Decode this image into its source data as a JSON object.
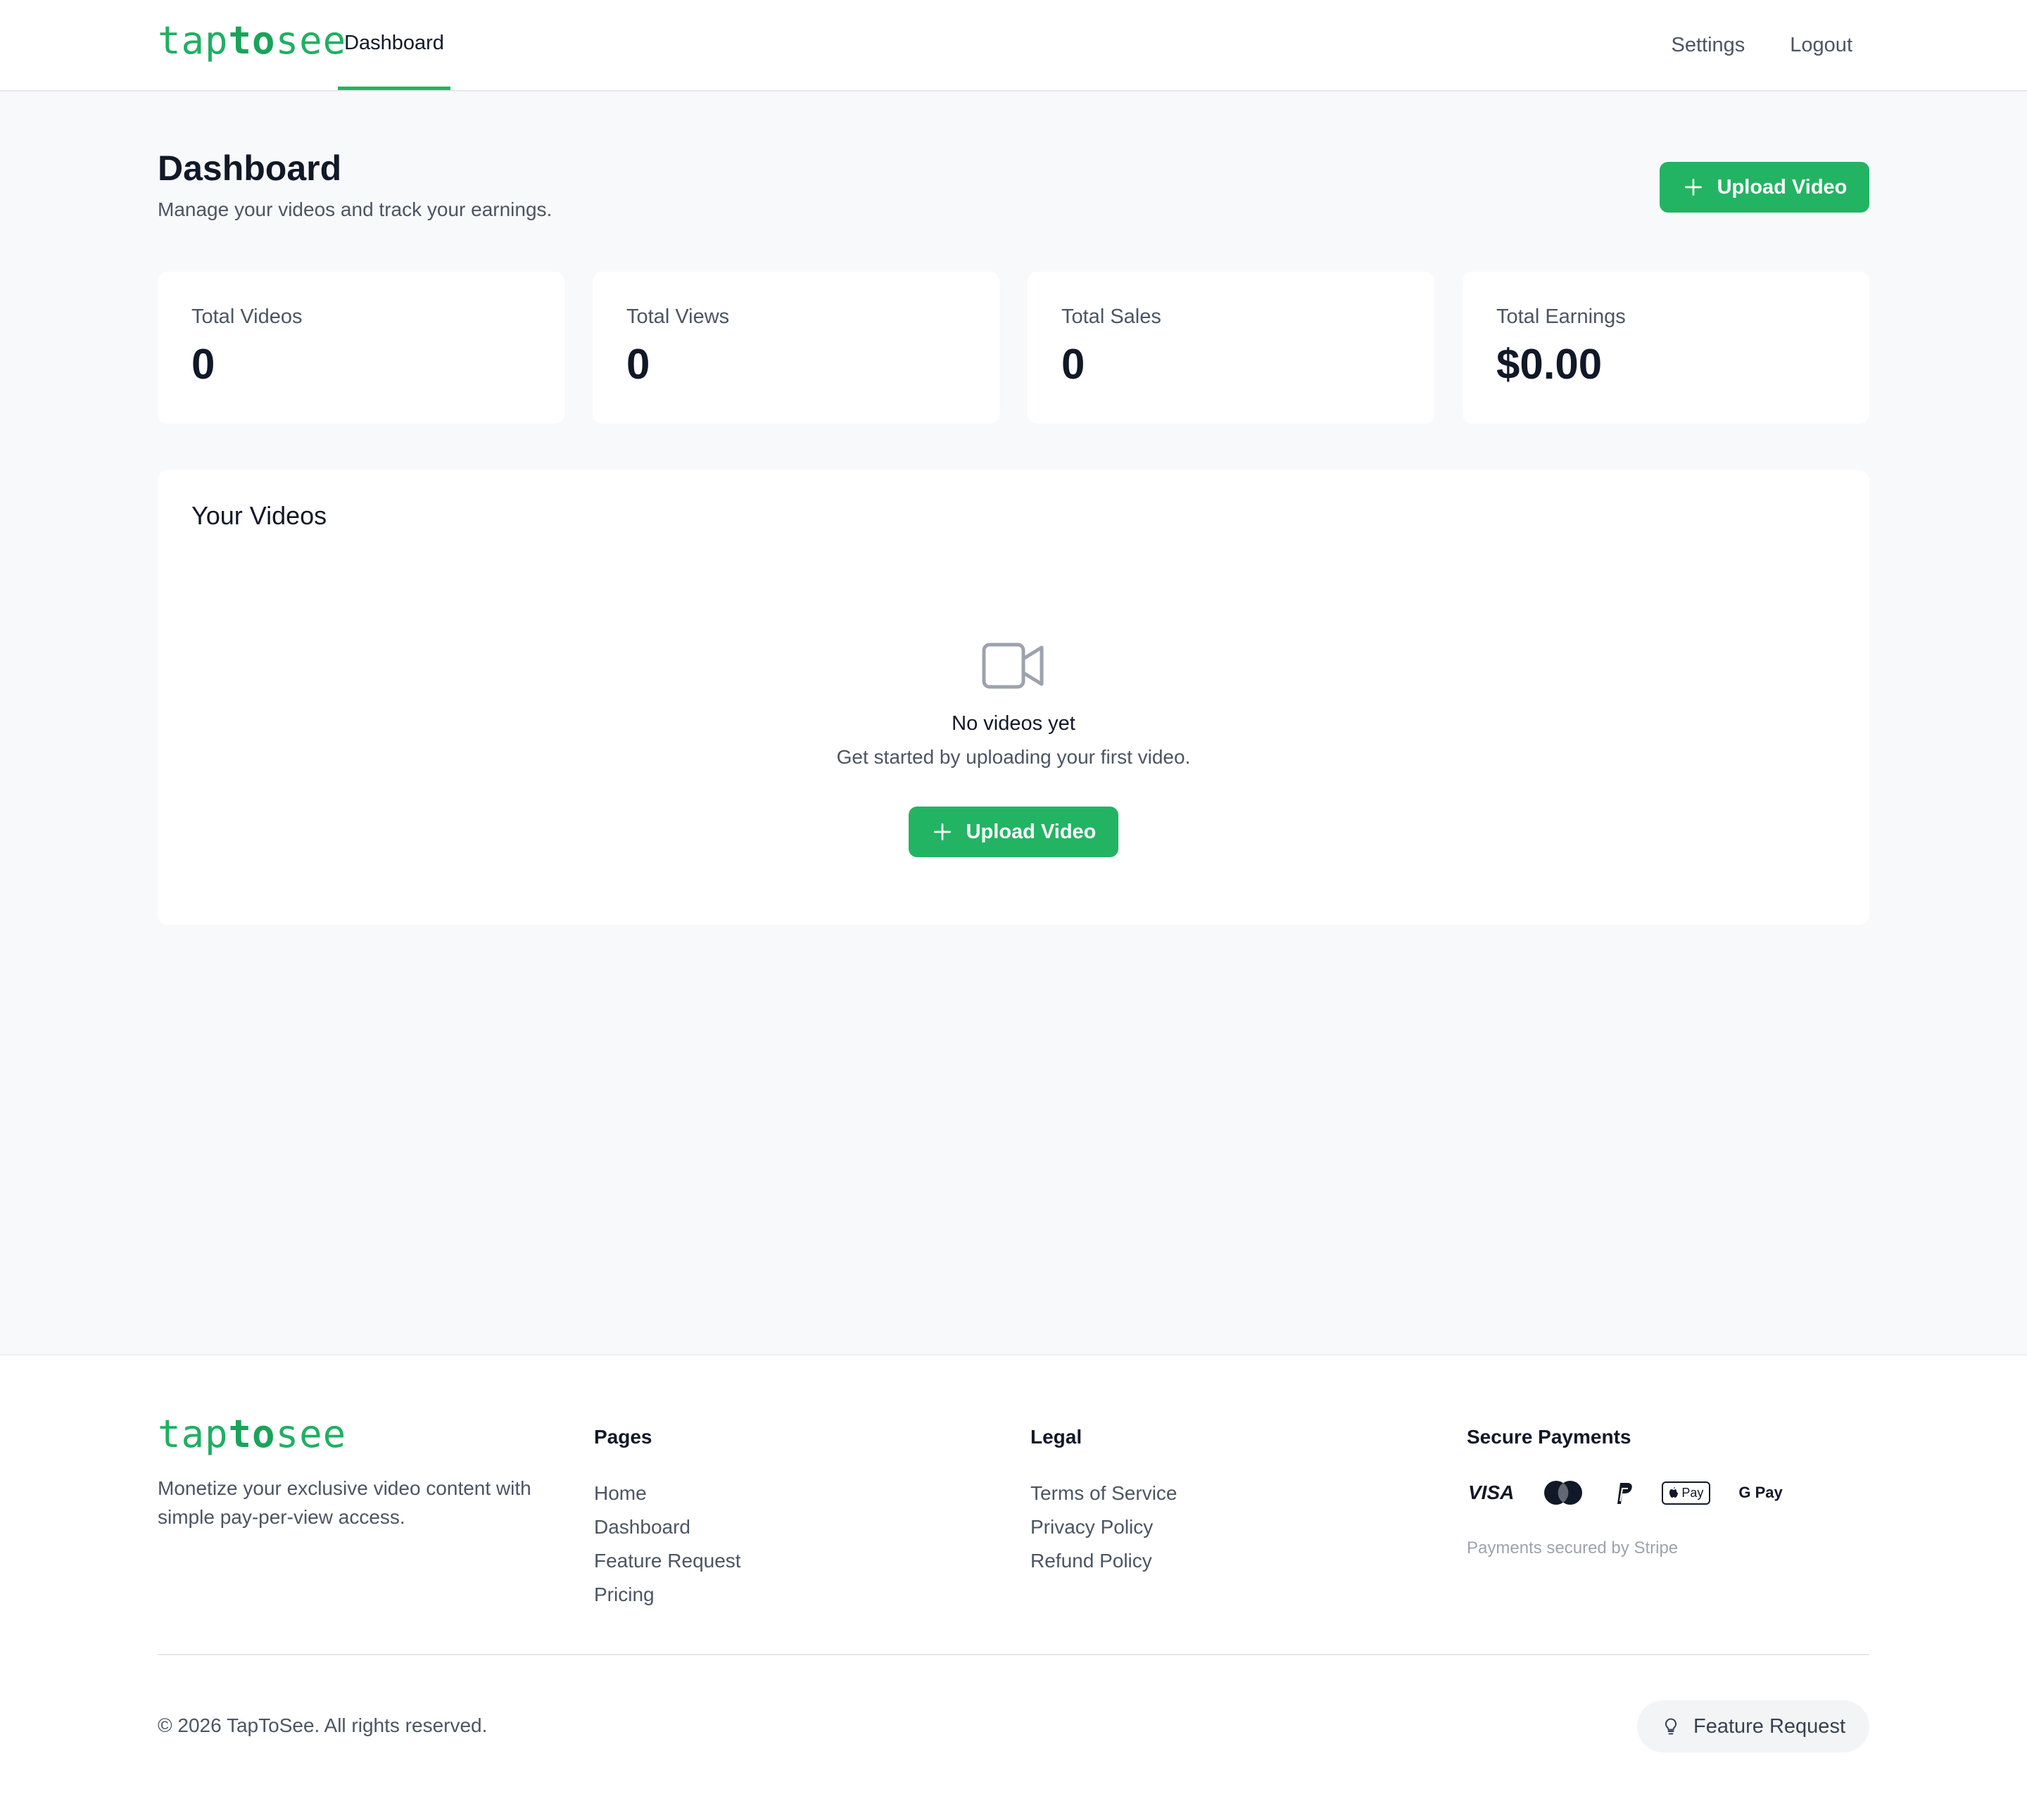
{
  "brand": {
    "logo_light": "tap",
    "logo_bold": "to",
    "logo_end": "see",
    "accent": "#22b463"
  },
  "header": {
    "tabs": [
      {
        "label": "Dashboard",
        "active": true
      }
    ],
    "settings_label": "Settings",
    "logout_label": "Logout"
  },
  "page": {
    "title": "Dashboard",
    "subtitle": "Manage your videos and track your earnings.",
    "upload_label": "Upload Video"
  },
  "stats": [
    {
      "label": "Total Videos",
      "value": "0"
    },
    {
      "label": "Total Views",
      "value": "0"
    },
    {
      "label": "Total Sales",
      "value": "0"
    },
    {
      "label": "Total Earnings",
      "value": "$0.00"
    }
  ],
  "videos": {
    "title": "Your Videos",
    "empty_icon": "video-camera-icon",
    "empty_title": "No videos yet",
    "empty_subtitle": "Get started by uploading your first video.",
    "upload_label": "Upload Video"
  },
  "footer": {
    "tagline": "Monetize your exclusive video content with simple pay-per-view access.",
    "pages_title": "Pages",
    "pages": [
      "Home",
      "Dashboard",
      "Feature Request",
      "Pricing"
    ],
    "legal_title": "Legal",
    "legal": [
      "Terms of Service",
      "Privacy Policy",
      "Refund Policy"
    ],
    "payments_title": "Secure Payments",
    "payment_icons": {
      "visa": "VISA",
      "mastercard": "mastercard-icon",
      "paypal": "paypal-icon",
      "apple_pay": "Pay",
      "google_pay": "G Pay"
    },
    "payments_note": "Payments secured by Stripe",
    "copyright": "© 2026 TapToSee. All rights reserved.",
    "feature_request_label": "Feature Request"
  }
}
